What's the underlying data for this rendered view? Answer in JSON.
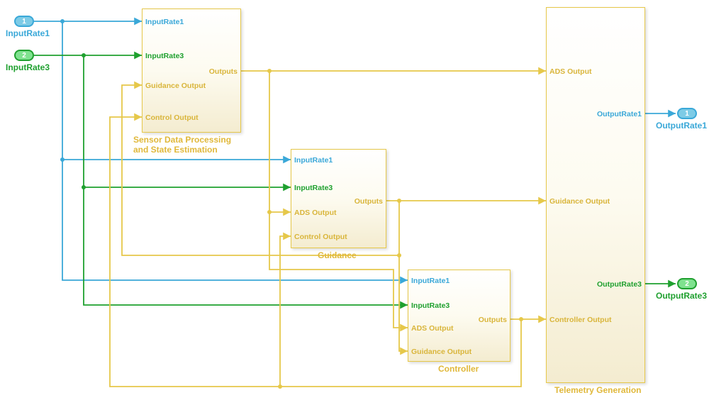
{
  "colors": {
    "blue": "#3aa8d8",
    "green": "#1fa02f",
    "yellow": "#e6c84a",
    "yellow_text": "#d9b53a"
  },
  "inports": [
    {
      "num": "1",
      "label": "InputRate1",
      "color": "blue"
    },
    {
      "num": "2",
      "label": "InputRate3",
      "color": "green"
    }
  ],
  "outports": [
    {
      "num": "1",
      "label": "OutputRate1",
      "color": "blue"
    },
    {
      "num": "2",
      "label": "OutputRate3",
      "color": "green"
    }
  ],
  "blocks": {
    "sensor": {
      "title": "Sensor Data Processing\nand State Estimation",
      "inputs": [
        "InputRate1",
        "InputRate3",
        "Guidance Output",
        "Control Output"
      ],
      "outputs": [
        "Outputs"
      ]
    },
    "guidance": {
      "title": "Guidance",
      "inputs": [
        "InputRate1",
        "InputRate3",
        "ADS Output",
        "Control Output"
      ],
      "outputs": [
        "Outputs"
      ]
    },
    "controller": {
      "title": "Controller",
      "inputs": [
        "InputRate1",
        "InputRate3",
        "ADS Output",
        "Guidance Output"
      ],
      "outputs": [
        "Outputs"
      ]
    },
    "telemetry": {
      "title": "Telemetry Generation",
      "inputs": [
        "ADS Output",
        "Guidance Output",
        "Controller Output"
      ],
      "outputs": [
        "OutputRate1",
        "OutputRate3"
      ]
    }
  }
}
